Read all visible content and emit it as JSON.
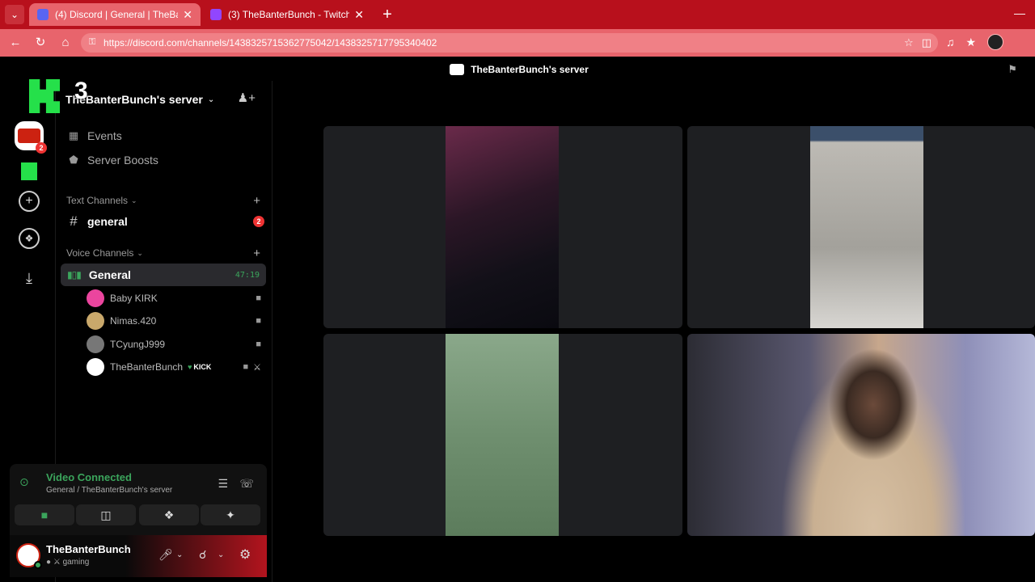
{
  "browser": {
    "tabs": [
      {
        "title": "(4) Discord | General | TheBan",
        "active": true
      },
      {
        "title": "(3) TheBanterBunch - Twitch",
        "active": false
      }
    ],
    "url": "https://discord.com/channels/1438325715362775042/1438325717795340402"
  },
  "app": {
    "window_title": "TheBanterBunch's server"
  },
  "overlay": {
    "kick_number": "3"
  },
  "guilds": {
    "server_badge": "2"
  },
  "sidebar": {
    "server_name": "TheBanterBunch's server",
    "items": [
      {
        "label": "Events",
        "icon": "calendar-icon"
      },
      {
        "label": "Server Boosts",
        "icon": "boost-icon"
      }
    ],
    "text_category": "Text Channels",
    "text_channels": [
      {
        "name": "general",
        "badge": "2"
      }
    ],
    "voice_category": "Voice Channels",
    "voice_channel": {
      "name": "General",
      "timer": "47:19"
    },
    "members": [
      {
        "name": "Baby KIRK",
        "color": "#eb459e"
      },
      {
        "name": "Nimas.420",
        "color": "#c9a86b"
      },
      {
        "name": "TCyungJ999",
        "color": "#8a8a8a"
      },
      {
        "name": "TheBanterBunch",
        "color": "#ffffff",
        "tag": "KICK"
      }
    ]
  },
  "voice_panel": {
    "status": "Video Connected",
    "location": "General / TheBanterBunch's server"
  },
  "user_panel": {
    "username": "TheBanterBunch",
    "status": "gaming"
  },
  "colors": {
    "accent_green": "#3ba55c",
    "browser_red": "#b8101c",
    "badge_red": "#ed4245"
  }
}
